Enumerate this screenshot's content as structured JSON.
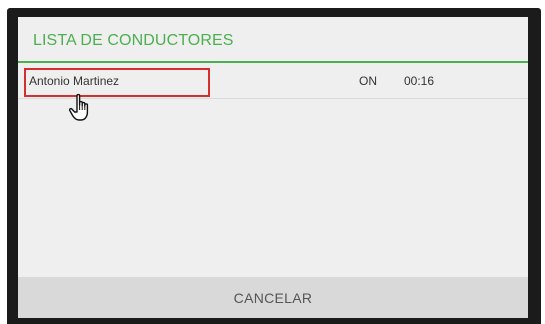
{
  "dialog": {
    "title": "LISTA DE CONDUCTORES",
    "accent_color": "#4caf50",
    "rows": [
      {
        "name": "Antonio Martinez",
        "status": "ON",
        "time": "00:16"
      }
    ],
    "cancel_label": "CANCELAR"
  },
  "overlay": {
    "highlight_color": "#d32f2f",
    "pointer_icon": "hand-pointer-icon"
  }
}
